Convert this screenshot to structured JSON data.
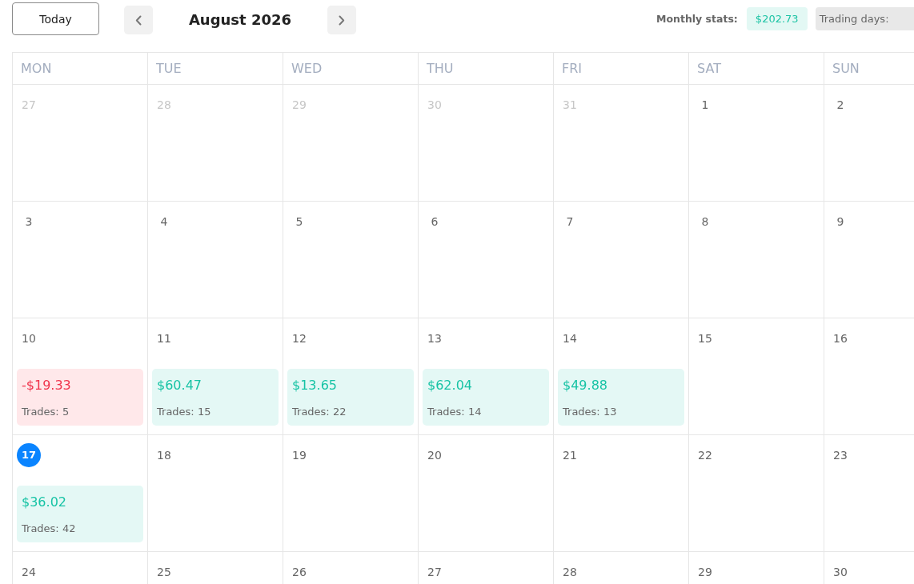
{
  "toolbar": {
    "today_button": "Today",
    "title": "August 2026",
    "stats_label": "Monthly stats:",
    "total": "$202.73",
    "trading_days": "Trading days:"
  },
  "calendar": {
    "weekdays": [
      "MON",
      "TUE",
      "WED",
      "THU",
      "FRI",
      "SAT",
      "SUN"
    ],
    "weeks": [
      [
        {
          "day": "27",
          "outside": true,
          "today": false
        },
        {
          "day": "28",
          "outside": true,
          "today": false
        },
        {
          "day": "29",
          "outside": true,
          "today": false
        },
        {
          "day": "30",
          "outside": true,
          "today": false
        },
        {
          "day": "31",
          "outside": true,
          "today": false
        },
        {
          "day": "1",
          "outside": false,
          "today": false
        },
        {
          "day": "2",
          "outside": false,
          "today": false
        }
      ],
      [
        {
          "day": "3",
          "outside": false,
          "today": false
        },
        {
          "day": "4",
          "outside": false,
          "today": false
        },
        {
          "day": "5",
          "outside": false,
          "today": false
        },
        {
          "day": "6",
          "outside": false,
          "today": false
        },
        {
          "day": "7",
          "outside": false,
          "today": false
        },
        {
          "day": "8",
          "outside": false,
          "today": false
        },
        {
          "day": "9",
          "outside": false,
          "today": false
        }
      ],
      [
        {
          "day": "10",
          "outside": false,
          "today": false,
          "entry": {
            "kind": "loss",
            "pnl": "-$19.33",
            "trades": "Trades: 5"
          }
        },
        {
          "day": "11",
          "outside": false,
          "today": false,
          "entry": {
            "kind": "gain",
            "pnl": "$60.47",
            "trades": "Trades: 15"
          }
        },
        {
          "day": "12",
          "outside": false,
          "today": false,
          "entry": {
            "kind": "gain",
            "pnl": "$13.65",
            "trades": "Trades: 22"
          }
        },
        {
          "day": "13",
          "outside": false,
          "today": false,
          "entry": {
            "kind": "gain",
            "pnl": "$62.04",
            "trades": "Trades: 14"
          }
        },
        {
          "day": "14",
          "outside": false,
          "today": false,
          "entry": {
            "kind": "gain",
            "pnl": "$49.88",
            "trades": "Trades: 13"
          }
        },
        {
          "day": "15",
          "outside": false,
          "today": false
        },
        {
          "day": "16",
          "outside": false,
          "today": false
        }
      ],
      [
        {
          "day": "17",
          "outside": false,
          "today": true,
          "entry": {
            "kind": "gain",
            "pnl": "$36.02",
            "trades": "Trades: 42"
          }
        },
        {
          "day": "18",
          "outside": false,
          "today": false
        },
        {
          "day": "19",
          "outside": false,
          "today": false
        },
        {
          "day": "20",
          "outside": false,
          "today": false
        },
        {
          "day": "21",
          "outside": false,
          "today": false
        },
        {
          "day": "22",
          "outside": false,
          "today": false
        },
        {
          "day": "23",
          "outside": false,
          "today": false
        }
      ],
      [
        {
          "day": "24",
          "outside": false,
          "today": false
        },
        {
          "day": "25",
          "outside": false,
          "today": false
        },
        {
          "day": "26",
          "outside": false,
          "today": false
        },
        {
          "day": "27",
          "outside": false,
          "today": false
        },
        {
          "day": "28",
          "outside": false,
          "today": false
        },
        {
          "day": "29",
          "outside": false,
          "today": false
        },
        {
          "day": "30",
          "outside": false,
          "today": false
        }
      ]
    ]
  }
}
